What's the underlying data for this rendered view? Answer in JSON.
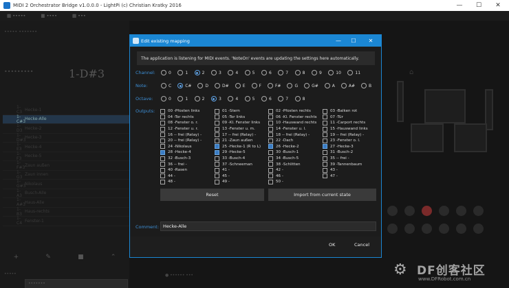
{
  "window": {
    "title": "MIDI 2 Orchestrator Bridge v1.0.0.0 - LightPi (c) Christian Kratky 2016"
  },
  "dialog": {
    "title": "Edit existing mapping",
    "info": "The application is listening for MIDI events. 'NoteOn' events are updating the settings here automatically.",
    "channel_label": "Channel:",
    "note_label": "Note:",
    "octave_label": "Octave:",
    "outputs_label": "Outputs:",
    "comment_label": "Comment:",
    "channels": [
      "0",
      "1",
      "2",
      "3",
      "4",
      "5",
      "6",
      "7",
      "8",
      "9",
      "10",
      "11"
    ],
    "channel_selected": "2",
    "notes": [
      "C",
      "C#",
      "D",
      "D#",
      "E",
      "F",
      "F#",
      "G",
      "G#",
      "A",
      "A#",
      "B"
    ],
    "note_selected": "C#",
    "octaves": [
      "0",
      "1",
      "2",
      "3",
      "4",
      "5",
      "6",
      "7",
      "8"
    ],
    "octave_selected": "3",
    "outputs": [
      [
        {
          "label": "00 -Pfosten links",
          "checked": false
        },
        {
          "label": "04 -Tor rechts",
          "checked": false
        },
        {
          "label": "08 -Fenster o. r.",
          "checked": false
        },
        {
          "label": "12 -Fenster u. r.",
          "checked": false
        },
        {
          "label": "16 -- frei (Relay) -",
          "checked": false
        },
        {
          "label": "20 -- frei (Relay) -",
          "checked": false
        },
        {
          "label": "24 -Nikolaus",
          "checked": false
        },
        {
          "label": "28 -Hecke-4",
          "checked": true
        },
        {
          "label": "32 -Busch-3",
          "checked": false
        },
        {
          "label": "36 -- frei -",
          "checked": false
        },
        {
          "label": "40 -Rasen",
          "checked": false
        },
        {
          "label": "44 -",
          "checked": false
        },
        {
          "label": "48 -",
          "checked": false
        }
      ],
      [
        {
          "label": "01 -Stern",
          "checked": false
        },
        {
          "label": "05 -Tor links",
          "checked": false
        },
        {
          "label": "09 -Kl. Fenster links",
          "checked": false
        },
        {
          "label": "13 -Fenster u. m.",
          "checked": false
        },
        {
          "label": "17 -- frei (Relay) -",
          "checked": false
        },
        {
          "label": "21 -Zaun außen",
          "checked": false
        },
        {
          "label": "25 -Hecke-1 (R to L)",
          "checked": true
        },
        {
          "label": "29 -Hecke-5",
          "checked": true
        },
        {
          "label": "33 -Busch-4",
          "checked": false
        },
        {
          "label": "37 -Schneeman",
          "checked": false
        },
        {
          "label": "41 -",
          "checked": false
        },
        {
          "label": "45 -",
          "checked": false
        },
        {
          "label": "49 -",
          "checked": false
        }
      ],
      [
        {
          "label": "02 -Pfosten rechts",
          "checked": false
        },
        {
          "label": "06 -Kl. Fenster rechts",
          "checked": false
        },
        {
          "label": "10 -Hauswand rechts",
          "checked": false
        },
        {
          "label": "14 -Fenster u. l.",
          "checked": false
        },
        {
          "label": "18 -- frei (Relay) -",
          "checked": false
        },
        {
          "label": "22 -Dach",
          "checked": false
        },
        {
          "label": "26 -Hecke-2",
          "checked": true
        },
        {
          "label": "30 -Busch-1",
          "checked": false
        },
        {
          "label": "34 -Busch-5",
          "checked": false
        },
        {
          "label": "38 -Schlitten",
          "checked": false
        },
        {
          "label": "42 -",
          "checked": false
        },
        {
          "label": "46 -",
          "checked": false
        },
        {
          "label": "50 -",
          "checked": false
        }
      ],
      [
        {
          "label": "03 -Balken rot",
          "checked": false
        },
        {
          "label": "07 -Tür",
          "checked": false
        },
        {
          "label": "11 -Carport rechts",
          "checked": false
        },
        {
          "label": "15 -Hauswand links",
          "checked": false
        },
        {
          "label": "19 -- frei (Relay) -",
          "checked": false
        },
        {
          "label": "23 -Fenster o. l.",
          "checked": false
        },
        {
          "label": "27 -Hecke-3",
          "checked": true
        },
        {
          "label": "31 -Busch-2",
          "checked": false
        },
        {
          "label": "35 -- frei -",
          "checked": false
        },
        {
          "label": "39 -Tannenbaum",
          "checked": false
        },
        {
          "label": "43 -",
          "checked": false
        },
        {
          "label": "47 -",
          "checked": false
        }
      ]
    ],
    "reset_label": "Reset",
    "import_label": "Import from current state",
    "comment_value": "Hecke-Alle",
    "ok_label": "OK",
    "cancel_label": "Cancel"
  },
  "background": {
    "note_display": "1-D#3",
    "list_rows": [
      {
        "c1": "1-C3",
        "c2": "Hecke-1"
      },
      {
        "c1": "1-C#3",
        "c2": "Hecke-Alle"
      },
      {
        "c1": "1-D3",
        "c2": "Hecke-2"
      },
      {
        "c1": "1-D#3",
        "c2": "Hecke-3"
      },
      {
        "c1": "1-E3",
        "c2": "Hecke-4"
      },
      {
        "c1": "1-F3",
        "c2": "Hecke-5"
      },
      {
        "c1": "1-F#3",
        "c2": "Zaun außen"
      },
      {
        "c1": "1-G3",
        "c2": "Zaun innen"
      },
      {
        "c1": "1-G#3",
        "c2": "Nikolaus"
      },
      {
        "c1": "1-A3",
        "c2": "Busch-Alle"
      },
      {
        "c1": "1-A#3",
        "c2": "Haus-Alle"
      },
      {
        "c1": "1-B3",
        "c2": "Haus-rechts"
      },
      {
        "c1": "1-C4",
        "c2": "Fenster-1"
      }
    ],
    "watermark": "DF创客社区",
    "watermark_url": "www.DFRobot.com.cn"
  },
  "colors": {
    "accent": "#1b87d4",
    "label_blue": "#3d8fd6",
    "checked": "#3a7cc4"
  }
}
